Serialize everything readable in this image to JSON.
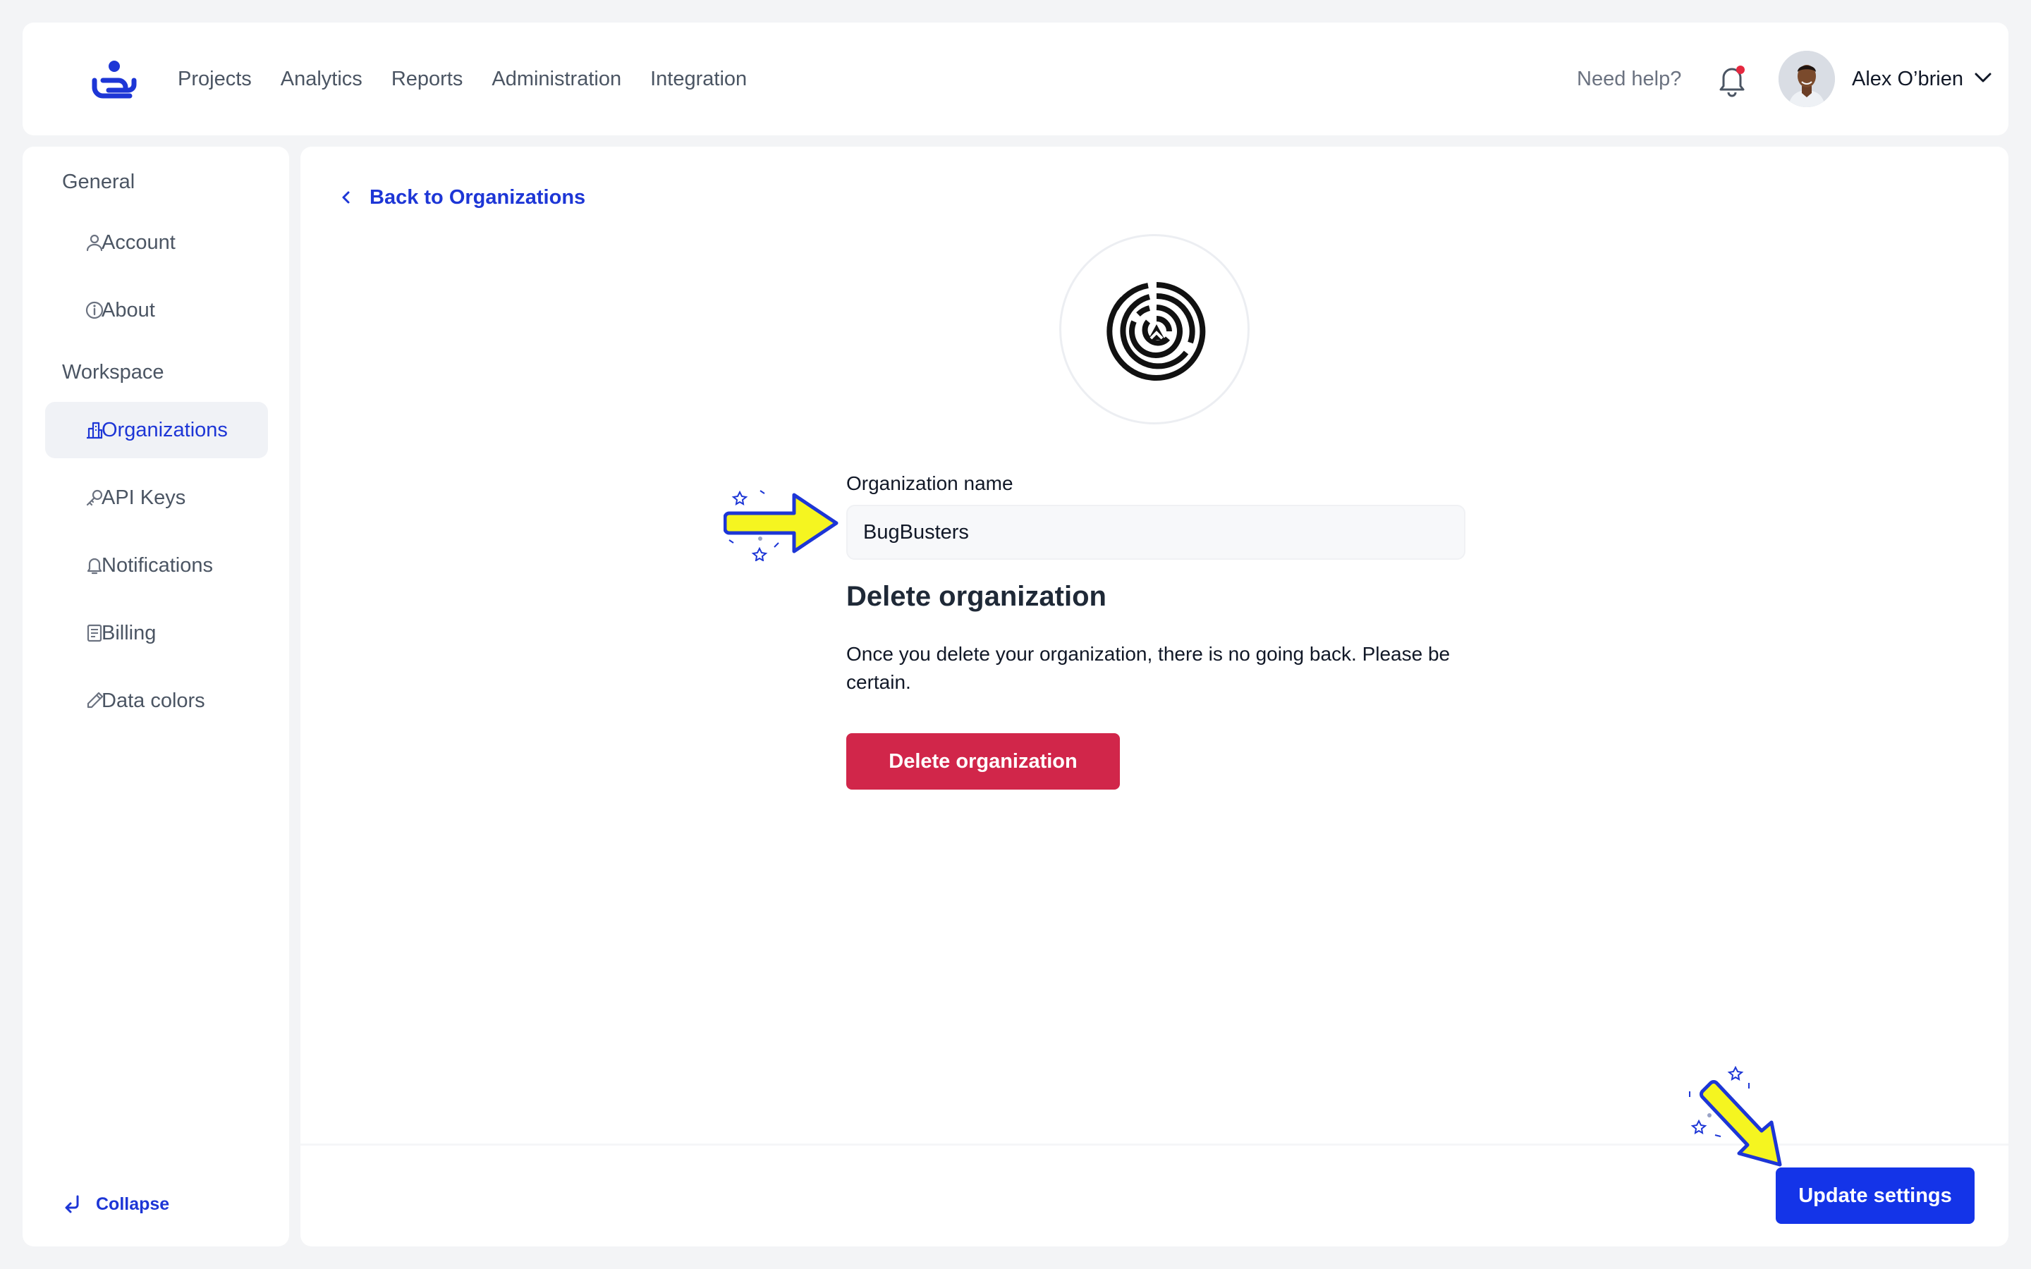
{
  "header": {
    "nav_items": [
      "Projects",
      "Analytics",
      "Reports",
      "Administration",
      "Integration"
    ],
    "help_label": "Need help?",
    "user_name": "Alex O’brien"
  },
  "sidebar": {
    "general_heading": "General",
    "workspace_heading": "Workspace",
    "items": [
      {
        "label": "Account",
        "icon": "user-icon"
      },
      {
        "label": "About",
        "icon": "info-icon"
      },
      {
        "label": "Organizations",
        "icon": "building-icon",
        "active": true
      },
      {
        "label": "API Keys",
        "icon": "key-icon"
      },
      {
        "label": "Notifications",
        "icon": "bell-icon"
      },
      {
        "label": "Billing",
        "icon": "document-icon"
      },
      {
        "label": "Data colors",
        "icon": "pen-icon"
      }
    ],
    "collapse_label": "Collapse"
  },
  "main": {
    "back_label": "Back to Organizations",
    "org_name_label": "Organization name",
    "org_name_value": "BugBusters",
    "delete_heading": "Delete organization",
    "delete_text": "Once you delete your organization, there is no going back. Please be certain.",
    "delete_button": "Delete organization",
    "update_button": "Update settings"
  },
  "colors": {
    "accent": "#1434e8",
    "link": "#1d36d6",
    "danger": "#d1264a",
    "annotation_arrow": "#f5f520",
    "notification_dot": "#e5283f"
  }
}
